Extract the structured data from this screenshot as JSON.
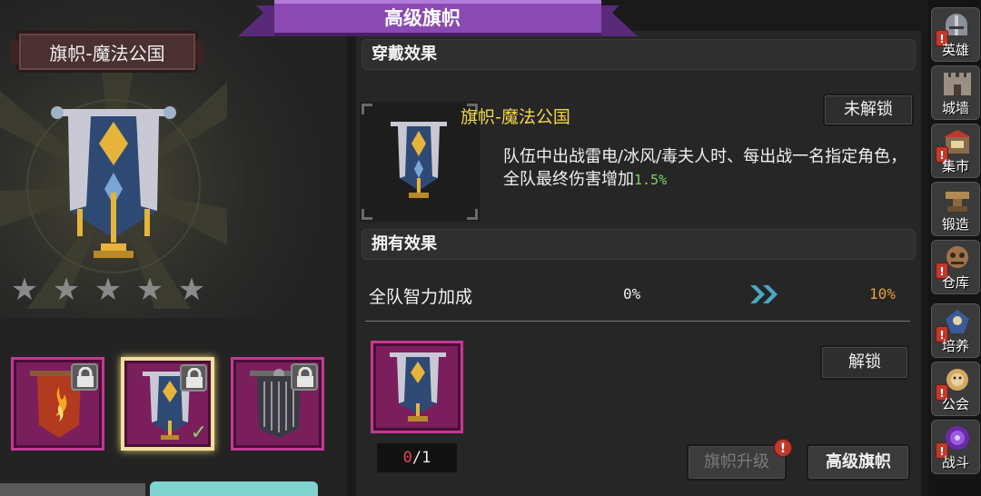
{
  "header": {
    "title": "高级旗帜"
  },
  "left": {
    "item_name": "旗帜-魔法公国",
    "stars_total": 5,
    "stars_filled": 0,
    "star_glyph": "★",
    "slots": [
      {
        "name": "fire-banner",
        "locked": true,
        "selected": false
      },
      {
        "name": "magic-kingdom-banner",
        "locked": true,
        "selected": true,
        "check": "✓"
      },
      {
        "name": "dark-chain-banner",
        "locked": true,
        "selected": false
      }
    ]
  },
  "wear_effect": {
    "header": "穿戴效果",
    "name": "旗帜-魔法公国",
    "status_button": "未解锁",
    "desc_main": "队伍中出战雷电/冰风/毒夫人时、每出战一名指定角色，全队最终伤害增加",
    "desc_value": "1.5%"
  },
  "own_effect": {
    "header": "拥有效果",
    "stat_label": "全队智力加成",
    "from": "0%",
    "to": "10%",
    "arrow_icon": "double-chevron-right-icon"
  },
  "inventory": {
    "have": "0",
    "separator": "/",
    "need": "1",
    "unlock_button": "解锁"
  },
  "footer": {
    "upgrade_button": "旗帜升级",
    "upgrade_badge": "!",
    "senior_button": "高级旗帜"
  },
  "nav": [
    {
      "label": "英雄",
      "icon": "helmet-icon",
      "badge": "!"
    },
    {
      "label": "城墙",
      "icon": "castle-wall-icon",
      "badge": ""
    },
    {
      "label": "集市",
      "icon": "market-icon",
      "badge": "!"
    },
    {
      "label": "锻造",
      "icon": "anvil-icon",
      "badge": ""
    },
    {
      "label": "仓库",
      "icon": "warehouse-icon",
      "badge": "!"
    },
    {
      "label": "培养",
      "icon": "training-icon",
      "badge": "!"
    },
    {
      "label": "公会",
      "icon": "guild-icon",
      "badge": "!"
    },
    {
      "label": "战斗",
      "icon": "battle-portal-icon",
      "badge": "!"
    }
  ],
  "colors": {
    "accent_purple": "#7a3a9a",
    "slot_magenta": "#7a1f5c",
    "name_yellow": "#f2d64a",
    "value_green": "#7ed957",
    "value_orange": "#e8a23a",
    "count_red": "#e04848"
  }
}
